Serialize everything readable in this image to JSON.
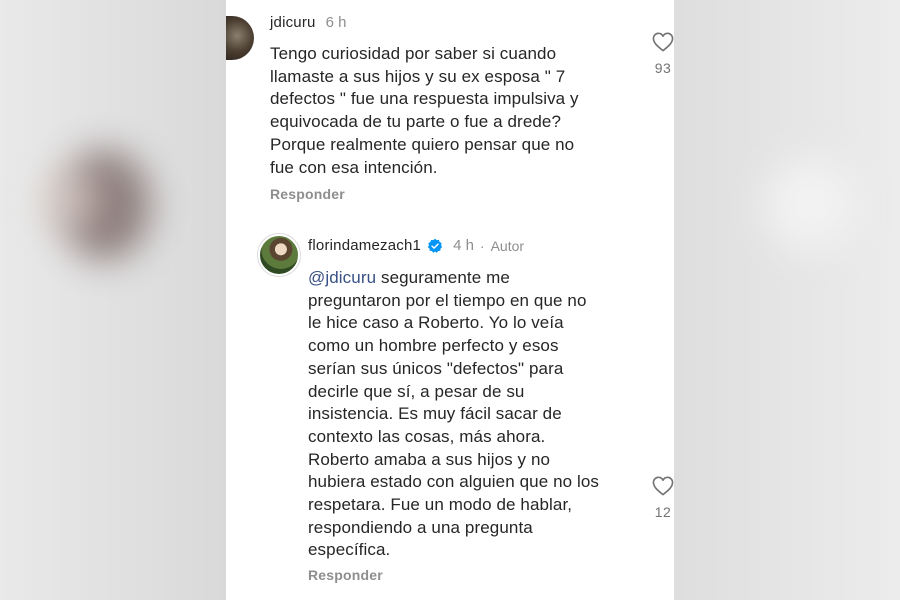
{
  "comments": [
    {
      "username": "jdicuru",
      "time": "6 h",
      "text": "Tengo curiosidad por saber si cuando\nllamaste a sus hijos y su ex esposa \" 7\ndefectos \" fue una respuesta impulsiva y\nequivocada de tu parte o fue a drede?\nPorque realmente quiero pensar que no\nfue con esa intención.",
      "reply_label": "Responder",
      "like_count": "93",
      "like_icon": "heart-outline-icon"
    },
    {
      "username": "florindamezach1",
      "verified": true,
      "time": "4 h",
      "separator": "·",
      "author_label": "Autor",
      "mention": "@jdicuru",
      "text": " seguramente me\npreguntaron por el tiempo en que no\nle hice caso a Roberto. Yo lo veía\ncomo un hombre perfecto y esos\nserían sus únicos \"defectos\" para\ndecirle que sí, a pesar de su\ninsistencia. Es muy fácil sacar de\ncontexto las cosas, más ahora.\nRoberto amaba a sus hijos y no\nhubiera estado con alguien que no los\nrespetara. Fue un modo de hablar,\nrespondiendo a una pregunta\nespecífica.",
      "reply_label": "Responder",
      "like_count": "12",
      "like_icon": "heart-outline-icon"
    }
  ],
  "colors": {
    "verified_badge": "#0095f6",
    "mention": "#385185",
    "secondary_text": "#8e8e8e"
  }
}
